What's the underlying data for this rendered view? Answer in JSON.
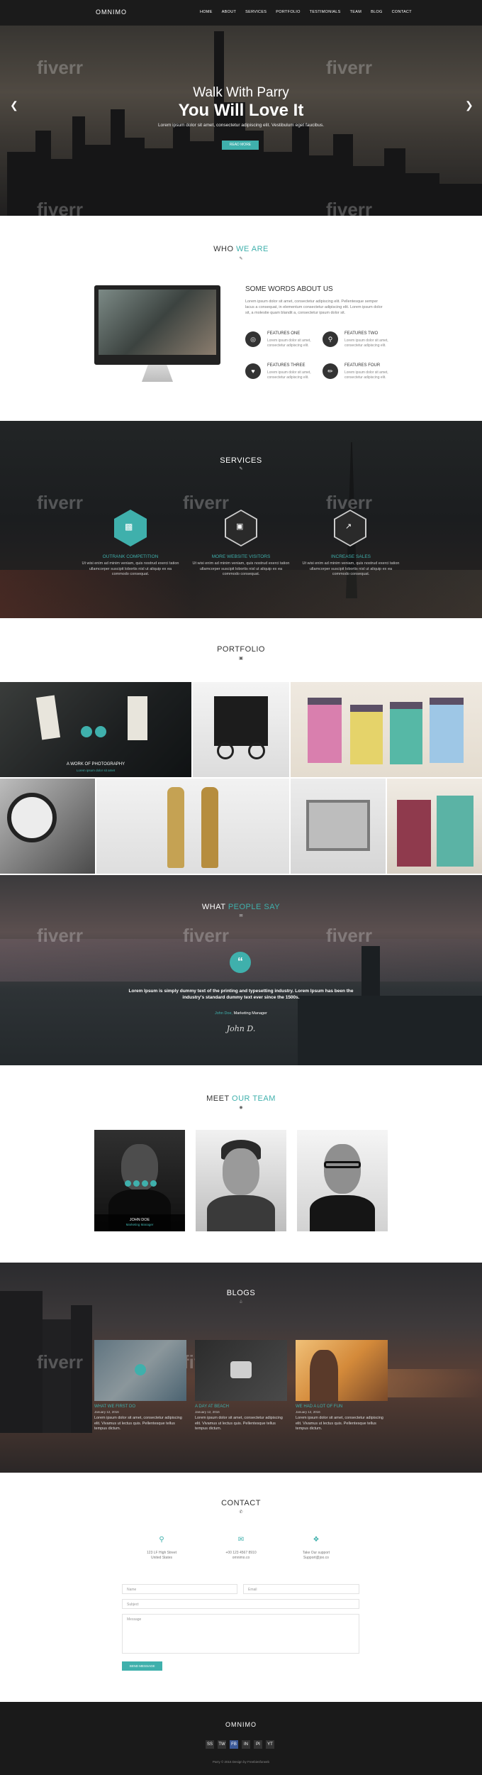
{
  "nav": {
    "brand": "OMNIMO",
    "items": [
      "HOME",
      "ABOUT",
      "SERVICES",
      "PORTFOLIO",
      "TESTIMONIALS",
      "TEAM",
      "BLOG",
      "CONTACT"
    ]
  },
  "hero": {
    "subtitle": "Walk With Parry",
    "title": "You Will Love It",
    "text": "Lorem ipsum dolor sit amet, consectetur adipiscing elit. Vestibulum eget faucibus.",
    "button": "READ MORE"
  },
  "about": {
    "heading_a": "WHO ",
    "heading_b": "WE ARE",
    "title": "SOME WORDS ABOUT US",
    "text": "Lorem ipsum dolor sit amet, consectetur adipiscing elit. Pellentesque semper lacus a consequat, in elementum consectetur adipiscing elit. Lorem ipsum dolor sit, a molestie quam blandit a, consectetur ipsum dolor sit.",
    "features": [
      {
        "title": "FEATURES ONE",
        "text": "Lorem ipsum dolor sit amet, consectetur adipiscing elit."
      },
      {
        "title": "FEATURES TWO",
        "text": "Lorem ipsum dolor sit amet, consectetur adipiscing elit."
      },
      {
        "title": "FEATURES THREE",
        "text": "Lorem ipsum dolor sit amet, consectetur adipiscing elit."
      },
      {
        "title": "FEATURES FOUR",
        "text": "Lorem ipsum dolor sit amet, consectetur adipiscing elit."
      }
    ]
  },
  "services": {
    "heading": "SERVICES",
    "items": [
      {
        "title": "OUTRANK COMPETITION",
        "text": "Ut wisi enim ad minim veniam, quis nostrud exerci tation ullamcorper suscipit lobortis nisl ut aliquip ex ea commodo consequat."
      },
      {
        "title": "MORE WEBSITE VISITORS",
        "text": "Ut wisi enim ad minim veniam, quis nostrud exerci tation ullamcorper suscipit lobortis nisl ut aliquip ex ea commodo consequat."
      },
      {
        "title": "INCREASE SALES",
        "text": "Ut wisi enim ad minim veniam, quis nostrud exerci tation ullamcorper suscipit lobortis nisl ut aliquip ex ea commodo consequat."
      }
    ]
  },
  "portfolio": {
    "heading": "PORTFOLIO",
    "caption": "A WORK OF PHOTOGRAPHY",
    "caption_sub": "Lorem ipsum dolor sit amet"
  },
  "testimonial": {
    "heading_a": "WHAT ",
    "heading_b": "PEOPLE SAY",
    "text": "Lorem Ipsum is simply dummy text of the printing and typesetting industry. Lorem Ipsum has been the industry's standard dummy text ever since the 1500s.",
    "author": "John Doe,",
    "role": " Marketing Manager",
    "signature": "John D."
  },
  "team": {
    "heading_a": "MEET ",
    "heading_b": "OUR TEAM",
    "name": "JOHN DOE",
    "role": "Marketing Manager"
  },
  "blogs": {
    "heading": "BLOGS",
    "items": [
      {
        "title": "WHAT WE FIRST DO",
        "date": "January 12, 2016",
        "text": "Lorem ipsum dolor sit amet, consectetur adipiscing elit. Vivamus ut lectus quis. Pellentesque tellus tempus dictum."
      },
      {
        "title": "A DAY AT BEACH",
        "date": "January 12, 2016",
        "text": "Lorem ipsum dolor sit amet, consectetur adipiscing elit. Vivamus ut lectus quis. Pellentesque tellus tempus dictum."
      },
      {
        "title": "WE HAD A LOT OF FUN",
        "date": "January 12, 2016",
        "text": "Lorem ipsum dolor sit amet, consectetur adipiscing elit. Vivamus ut lectus quis. Pellentesque tellus tempus dictum."
      }
    ]
  },
  "contact": {
    "heading": "CONTACT",
    "address": [
      "123 LF High Street",
      "United States"
    ],
    "phone": [
      "+00 123 4567 8910",
      "omnimo.co"
    ],
    "support": [
      "Take Our support",
      "Support@joo.co"
    ],
    "placeholders": {
      "name": "Name",
      "email": "Email",
      "subject": "Subject",
      "message": "Message"
    },
    "button": "SEND MESSAGE"
  },
  "footer": {
    "brand": "OMNIMO",
    "social": [
      "SS",
      "TW",
      "FB",
      "IN",
      "PI",
      "YT"
    ],
    "copyright": "Parry © 2016 Design by Freebiesforweb"
  },
  "watermark": "fiverr"
}
